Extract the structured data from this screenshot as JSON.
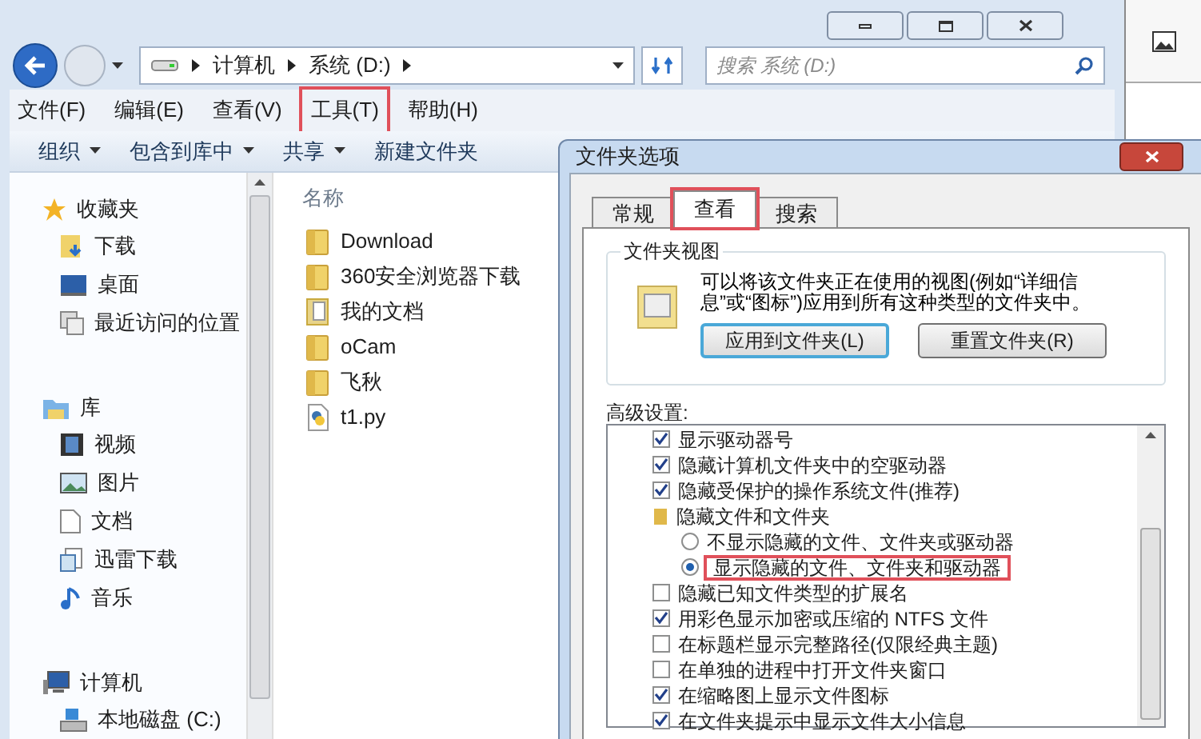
{
  "explorer": {
    "address": [
      "计算机",
      "系统 (D:)"
    ],
    "search": {
      "placeholder": "搜索 系统 (D:)"
    },
    "menu": [
      {
        "label": "文件(F)",
        "highlighted": false
      },
      {
        "label": "编辑(E)",
        "highlighted": false
      },
      {
        "label": "查看(V)",
        "highlighted": false
      },
      {
        "label": "工具(T)",
        "highlighted": true
      },
      {
        "label": "帮助(H)",
        "highlighted": false
      }
    ],
    "toolbar": [
      {
        "label": "组织",
        "dropdown": true
      },
      {
        "label": "包含到库中",
        "dropdown": true
      },
      {
        "label": "共享",
        "dropdown": true
      },
      {
        "label": "新建文件夹",
        "dropdown": false
      }
    ],
    "sidebar": [
      {
        "label": "收藏夹",
        "children": [
          {
            "label": "下载"
          },
          {
            "label": "桌面"
          },
          {
            "label": "最近访问的位置"
          }
        ]
      },
      {
        "label": "库",
        "children": [
          {
            "label": "视频"
          },
          {
            "label": "图片"
          },
          {
            "label": "文档"
          },
          {
            "label": "迅雷下载"
          },
          {
            "label": "音乐"
          }
        ]
      },
      {
        "label": "计算机",
        "children": [
          {
            "label": "本地磁盘 (C:)"
          }
        ]
      }
    ],
    "column": "名称",
    "files": [
      {
        "name": "Download",
        "kind": "folder"
      },
      {
        "name": "360安全浏览器下载",
        "kind": "folder"
      },
      {
        "name": "我的文档",
        "kind": "documents"
      },
      {
        "name": "oCam",
        "kind": "folder"
      },
      {
        "name": "飞秋",
        "kind": "folder"
      },
      {
        "name": "t1.py",
        "kind": "python"
      }
    ]
  },
  "dialog": {
    "title": "文件夹选项",
    "tabs": [
      {
        "label": "常规",
        "selected": false,
        "highlighted": false
      },
      {
        "label": "查看",
        "selected": true,
        "highlighted": true
      },
      {
        "label": "搜索",
        "selected": false,
        "highlighted": false
      }
    ],
    "group_title": "文件夹视图",
    "description": "可以将该文件夹正在使用的视图(例如“详细信息”或“图标”)应用到所有这种类型的文件夹中。",
    "buttons": [
      {
        "label": "应用到文件夹(L)",
        "default": true
      },
      {
        "label": "重置文件夹(R)",
        "default": false
      }
    ],
    "advanced_label": "高级设置:",
    "settings": [
      {
        "kind": "checkbox",
        "label": "显示驱动器号",
        "checked": true
      },
      {
        "kind": "checkbox",
        "label": "隐藏计算机文件夹中的空驱动器",
        "checked": true
      },
      {
        "kind": "checkbox",
        "label": "隐藏受保护的操作系统文件(推荐)",
        "checked": true
      },
      {
        "kind": "folder",
        "label": "隐藏文件和文件夹"
      },
      {
        "kind": "radio",
        "label": "不显示隐藏的文件、文件夹或驱动器",
        "selected": false,
        "highlighted": false
      },
      {
        "kind": "radio",
        "label": "显示隐藏的文件、文件夹和驱动器",
        "selected": true,
        "highlighted": true
      },
      {
        "kind": "checkbox",
        "label": "隐藏已知文件类型的扩展名",
        "checked": false
      },
      {
        "kind": "checkbox",
        "label": "用彩色显示加密或压缩的 NTFS 文件",
        "checked": true
      },
      {
        "kind": "checkbox",
        "label": "在标题栏显示完整路径(仅限经典主题)",
        "checked": false
      },
      {
        "kind": "checkbox",
        "label": "在单独的进程中打开文件夹窗口",
        "checked": false
      },
      {
        "kind": "checkbox",
        "label": "在缩略图上显示文件图标",
        "checked": true
      },
      {
        "kind": "checkbox",
        "label": "在文件夹提示中显示文件大小信息",
        "checked": true
      }
    ]
  }
}
